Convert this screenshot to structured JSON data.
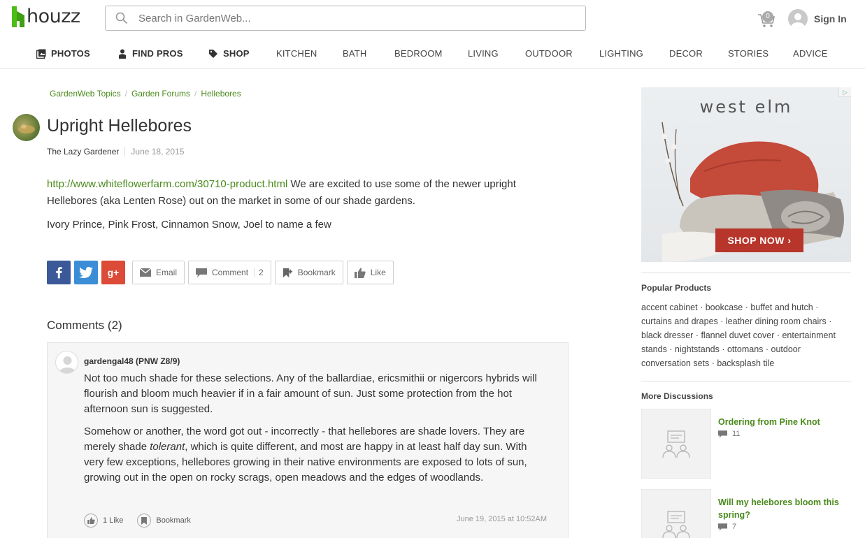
{
  "header": {
    "logo_text": "houzz",
    "search_placeholder": "Search in GardenWeb...",
    "cart_count": "0",
    "signin_label": "Sign In"
  },
  "nav": {
    "items": [
      {
        "label": "PHOTOS",
        "icon": "photos-icon"
      },
      {
        "label": "FIND PROS",
        "icon": "person-icon"
      },
      {
        "label": "SHOP",
        "icon": "tag-icon"
      },
      {
        "label": "KITCHEN"
      },
      {
        "label": "BATH"
      },
      {
        "label": "BEDROOM"
      },
      {
        "label": "LIVING"
      },
      {
        "label": "OUTDOOR"
      },
      {
        "label": "LIGHTING"
      },
      {
        "label": "DECOR"
      },
      {
        "label": "STORIES"
      },
      {
        "label": "ADVICE"
      }
    ]
  },
  "breadcrumb": [
    "GardenWeb Topics",
    "Garden Forums",
    "Hellebores"
  ],
  "post": {
    "title": "Upright Hellebores",
    "author": "The Lazy Gardener",
    "date": "June 18, 2015",
    "link": "http://www.whiteflowerfarm.com/30710-product.html",
    "body_after_link": " We are excited to use some of the newer upright Hellebores (aka Lenten Rose) out on the market in some of our shade gardens.",
    "body_2": "Ivory Prince, Pink Frost, Cinnamon Snow, Joel to name a few"
  },
  "actions": {
    "email": "Email",
    "comment": "Comment",
    "comment_count": "2",
    "bookmark": "Bookmark",
    "like": "Like"
  },
  "comments": {
    "title": "Comments (2)",
    "items": [
      {
        "author": "gardengal48 (PNW Z8/9)",
        "p1": "Not too much shade for these selections. Any of the ballardiae, ericsmithii or nigercors hybrids will flourish and bloom much heavier if in a fair amount of sun. Just some protection from the hot afternoon sun is suggested.",
        "p2_before": "Somehow or another, the word got out - incorrectly - that hellebores are shade lovers. They are merely shade ",
        "p2_em": "tolerant",
        "p2_after": ", which is quite different, and most are happy in at least half day sun. With very few exceptions, hellebores growing in their native environments are exposed to lots of sun, growing out in the open on rocky scrags, open meadows and the edges of woodlands.",
        "like_label": "1 Like",
        "bookmark_label": "Bookmark",
        "date": "June 19, 2015 at 10:52AM"
      }
    ]
  },
  "ad": {
    "brand": "west elm",
    "cta": "SHOP NOW ›"
  },
  "sidebar": {
    "popular_title": "Popular Products",
    "popular_text": "accent cabinet · bookcase · buffet and hutch · curtains and drapes · leather dining room chairs · black dresser · flannel duvet cover · entertainment stands · nightstands · ottomans · outdoor conversation sets · backsplash tile",
    "more_title": "More Discussions",
    "discussions": [
      {
        "title": "Ordering from Pine Knot",
        "count": "11"
      },
      {
        "title": "Will my helebores bloom this spring?",
        "count": "7"
      }
    ]
  },
  "colors": {
    "brand_green": "#4a8a1c",
    "facebook": "#3b5998",
    "twitter": "#3b8ed6",
    "googleplus": "#dc4a38",
    "ad_cta": "#b7352a"
  }
}
